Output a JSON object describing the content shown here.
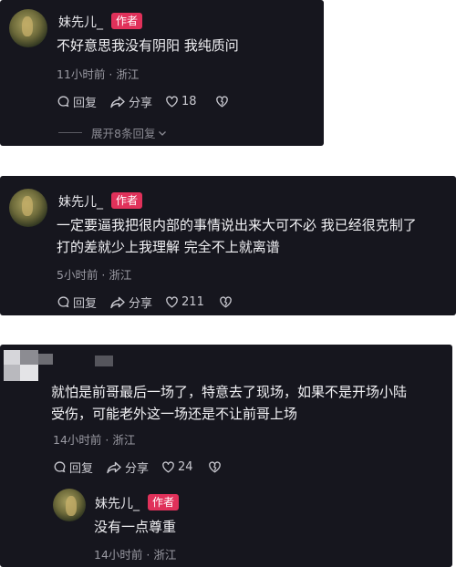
{
  "comments": [
    {
      "author": "妹先儿_",
      "badge": "作者",
      "text": "不好意思我没有阴阳 我纯质问",
      "meta": "11小时前 · 浙江",
      "reply_label": "回复",
      "share_label": "分享",
      "likes": "18",
      "expand_label": "展开8条回复"
    },
    {
      "author": "妹先儿_",
      "badge": "作者",
      "text_line1": "一定要逼我把很内部的事情说出来大可不必 我已经很克制了",
      "text_line2": "打的差就少上我理解  完全不上就离谱",
      "meta": "5小时前 · 浙江",
      "reply_label": "回复",
      "share_label": "分享",
      "likes": "211"
    },
    {
      "author": "",
      "text_line1": "就怕是前哥最后一场了，特意去了现场，如果不是开场小陆",
      "text_line2": "受伤，可能老外这一场还是不让前哥上场",
      "meta": "14小时前 · 浙江",
      "reply_label": "回复",
      "share_label": "分享",
      "likes": "24",
      "reply": {
        "author": "妹先儿_",
        "badge": "作者",
        "text": "没有一点尊重",
        "meta": "14小时前 · 浙江"
      }
    }
  ],
  "icons": {
    "reply": "reply-icon",
    "share": "share-icon",
    "like": "heart-icon",
    "dislike": "broken-heart-icon",
    "expand": "chevron-down-icon"
  },
  "colors": {
    "card_bg": "#16161e",
    "badge_bg": "#e0315a",
    "meta_text": "#9a9aa3"
  }
}
